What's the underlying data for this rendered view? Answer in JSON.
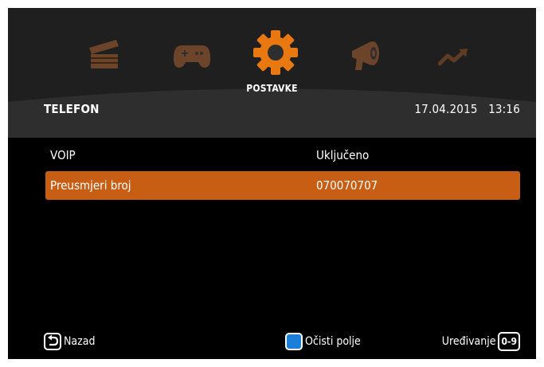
{
  "menu": {
    "icons": [
      "clapperboard-icon",
      "gamepad-icon",
      "gear-icon",
      "megaphone-icon",
      "trend-arrow-icon"
    ],
    "active_label": "POSTAVKE",
    "active_color": "#e8780f",
    "inactive_color": "#7a4a2a"
  },
  "header": {
    "title": "TELEFON",
    "date": "17.04.2015",
    "time": "13:16"
  },
  "settings": {
    "rows": [
      {
        "label": "VOIP",
        "value": "Uključeno",
        "selected": false
      },
      {
        "label": "Preusmjeri broj",
        "value": "070070707",
        "selected": true
      }
    ],
    "highlight_color": "#c85e14"
  },
  "footer": {
    "back_label": "Nazad",
    "clear_label": "Očisti polje",
    "edit_label": "Uređivanje",
    "edit_key": "0-9",
    "clear_key_color": "#1b7fd9"
  }
}
